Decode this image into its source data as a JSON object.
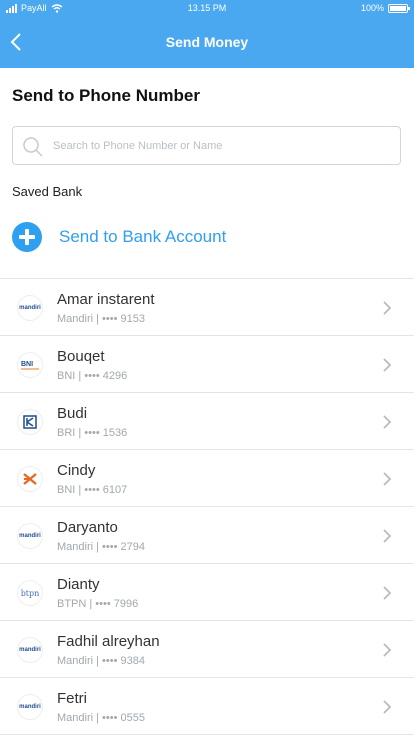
{
  "status": {
    "carrier": "PayAll",
    "time": "13.15 PM",
    "battery": "100%"
  },
  "header": {
    "title": "Send Money"
  },
  "section_title": "Send to Phone Number",
  "search": {
    "placeholder": "Search to Phone Number or Name",
    "value": ""
  },
  "saved_label": "Saved Bank",
  "add_label": "Send to Bank Account",
  "colors": {
    "header": "#4aa8f0",
    "accent": "#2f9ff0"
  },
  "contacts": [
    {
      "name": "Amar instarent",
      "detail": "Mandiri | •••• 9153",
      "bank": "mandiri"
    },
    {
      "name": "Bouqet",
      "detail": "BNI | •••• 4296",
      "bank": "bni"
    },
    {
      "name": "Budi",
      "detail": "BRI | •••• 1536",
      "bank": "bri"
    },
    {
      "name": "Cindy",
      "detail": "BNI | •••• 6107",
      "bank": "bni-orange"
    },
    {
      "name": "Daryanto",
      "detail": "Mandiri | •••• 2794",
      "bank": "mandiri"
    },
    {
      "name": "Dianty",
      "detail": "BTPN | •••• 7996",
      "bank": "btpn"
    },
    {
      "name": "Fadhil alreyhan",
      "detail": "Mandiri | •••• 9384",
      "bank": "mandiri"
    },
    {
      "name": "Fetri",
      "detail": "Mandiri | •••• 0555",
      "bank": "mandiri"
    }
  ]
}
